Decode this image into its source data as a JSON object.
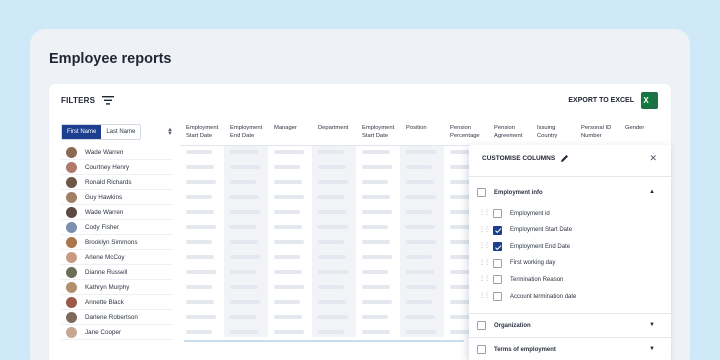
{
  "page": {
    "title": "Employee reports"
  },
  "toolbar": {
    "filters_label": "FILTERS",
    "export_label": "EXPORT TO EXCEL",
    "excel_glyph": "X"
  },
  "sort": {
    "first_name": "First Name",
    "last_name": "Last Name"
  },
  "employees": [
    {
      "name": "Wade Warren",
      "color": "#8a6a52"
    },
    {
      "name": "Courtney Henry",
      "color": "#b07a6a"
    },
    {
      "name": "Ronald Richards",
      "color": "#6f5649"
    },
    {
      "name": "Guy Hawkins",
      "color": "#a28064"
    },
    {
      "name": "Wade Warren",
      "color": "#5c4a42"
    },
    {
      "name": "Cody Fisher",
      "color": "#7d8fb0"
    },
    {
      "name": "Brooklyn Simmons",
      "color": "#a9764e"
    },
    {
      "name": "Arlene McCoy",
      "color": "#c89a82"
    },
    {
      "name": "Dianne Russell",
      "color": "#6c6f58"
    },
    {
      "name": "Kathryn Murphy",
      "color": "#b28f6c"
    },
    {
      "name": "Annette Black",
      "color": "#9a5a4a"
    },
    {
      "name": "Darlene Robertson",
      "color": "#806a5e"
    },
    {
      "name": "Jane Cooper",
      "color": "#c7a792"
    }
  ],
  "columns": [
    {
      "label": "Employment\nStart Date"
    },
    {
      "label": "Employment\nEnd Date"
    },
    {
      "label": "Manager"
    },
    {
      "label": "Department"
    },
    {
      "label": "Employment\nStart Date"
    },
    {
      "label": "Position"
    },
    {
      "label": "Pension\nPercentage"
    },
    {
      "label": "Pension\nAgreement"
    },
    {
      "label": "Issuing\nCountry"
    },
    {
      "label": "Personal ID\nNumber"
    },
    {
      "label": "Gender"
    }
  ],
  "panel": {
    "title": "CUSTOMISE COLUMNS",
    "sections": [
      {
        "label": "Employment info",
        "expanded": true
      },
      {
        "label": "Organization",
        "expanded": false
      },
      {
        "label": "Terms of employment",
        "expanded": false
      }
    ],
    "fields": [
      {
        "label": "Employment id",
        "checked": false
      },
      {
        "label": "Employment Start Date",
        "checked": true
      },
      {
        "label": "Employment End Date",
        "checked": true
      },
      {
        "label": "First working day",
        "checked": false
      },
      {
        "label": "Termination Reason",
        "checked": false
      },
      {
        "label": "Account termination date",
        "checked": false
      }
    ]
  },
  "colors": {
    "accent": "#1c3f8f",
    "background": "#cfe9f8",
    "excel": "#107c41"
  }
}
